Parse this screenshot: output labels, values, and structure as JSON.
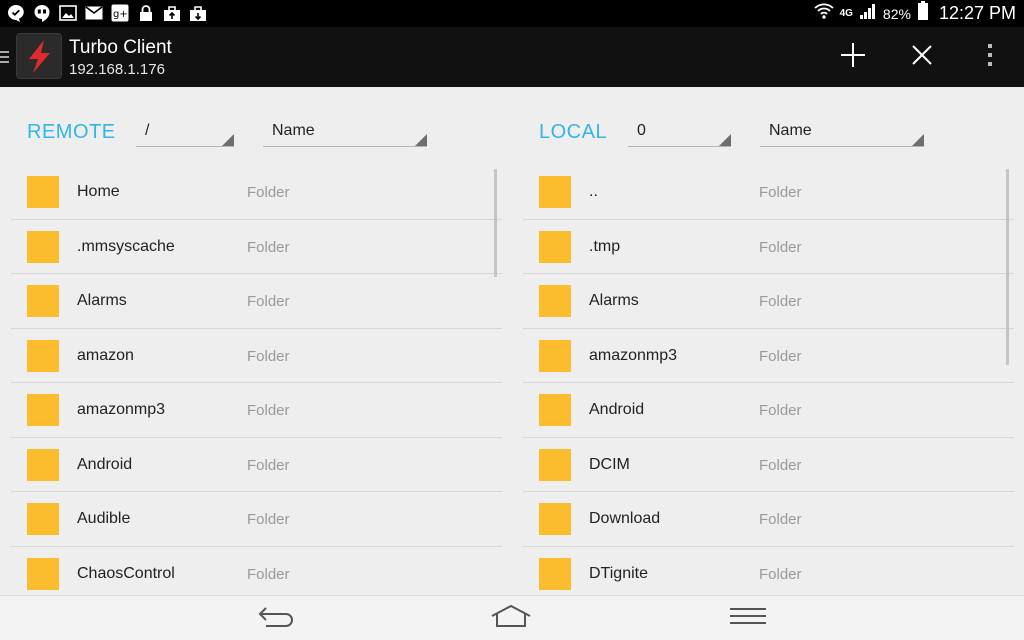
{
  "status_bar": {
    "left_icons": [
      "chat-bubble-icon",
      "hangouts-icon",
      "image-icon",
      "gmail-icon",
      "google-plus-icon",
      "lock-icon",
      "upload-bag-icon",
      "download-bag-icon"
    ],
    "network": "4G",
    "battery": "82%",
    "time": "12:27 PM"
  },
  "action_bar": {
    "title": "Turbo Client",
    "subtitle": "192.168.1.176",
    "actions": [
      "add-icon",
      "close-icon",
      "overflow-menu-icon"
    ]
  },
  "remote": {
    "label": "REMOTE",
    "path": "/",
    "sort": "Name",
    "files": [
      {
        "name": "Home",
        "type": "Folder"
      },
      {
        "name": ".mmsyscache",
        "type": "Folder"
      },
      {
        "name": "Alarms",
        "type": "Folder"
      },
      {
        "name": "amazon",
        "type": "Folder"
      },
      {
        "name": "amazonmp3",
        "type": "Folder"
      },
      {
        "name": "Android",
        "type": "Folder"
      },
      {
        "name": "Audible",
        "type": "Folder"
      },
      {
        "name": "ChaosControl",
        "type": "Folder"
      }
    ]
  },
  "local": {
    "label": "LOCAL",
    "path": "0",
    "sort": "Name",
    "files": [
      {
        "name": "..",
        "type": "Folder"
      },
      {
        "name": ".tmp",
        "type": "Folder"
      },
      {
        "name": "Alarms",
        "type": "Folder"
      },
      {
        "name": "amazonmp3",
        "type": "Folder"
      },
      {
        "name": "Android",
        "type": "Folder"
      },
      {
        "name": "DCIM",
        "type": "Folder"
      },
      {
        "name": "Download",
        "type": "Folder"
      },
      {
        "name": "DTignite",
        "type": "Folder"
      }
    ]
  },
  "nav_bar": [
    "back-icon",
    "home-icon",
    "menu-icon"
  ],
  "colors": {
    "accent": "#33b5e5",
    "folder": "#fbbd2d",
    "action_bar": "#111111",
    "background": "#eeeeee"
  }
}
